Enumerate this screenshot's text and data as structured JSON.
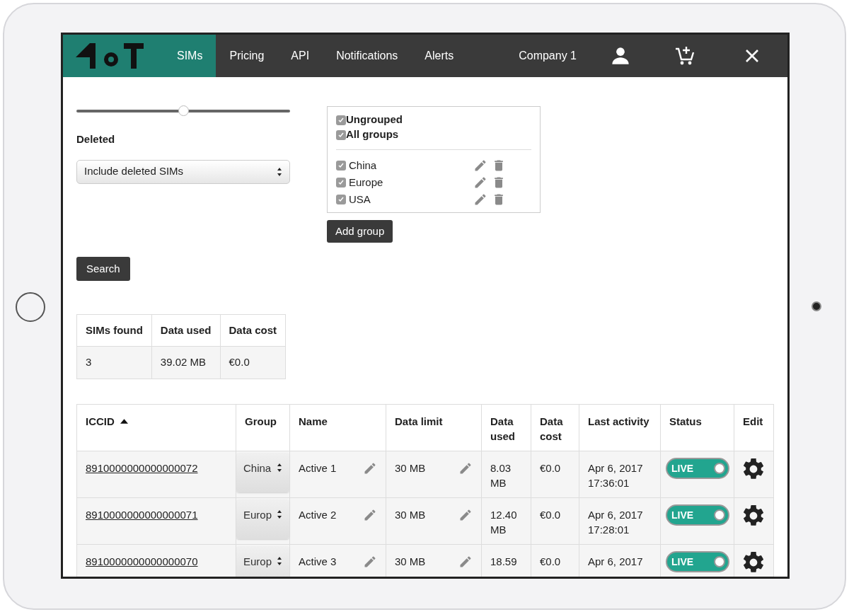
{
  "nav": {
    "tabs": [
      {
        "label": "SIMs",
        "selected": true
      },
      {
        "label": "Pricing",
        "selected": false
      },
      {
        "label": "API",
        "selected": false
      },
      {
        "label": "Notifications",
        "selected": false
      },
      {
        "label": "Alerts",
        "selected": false
      }
    ],
    "company": "Company 1"
  },
  "filters": {
    "slider": {
      "level": 0.5
    },
    "deleted_label": "Deleted",
    "deleted_value": "Include deleted SIMs",
    "search_button": "Search"
  },
  "group_filter": {
    "special": [
      {
        "label": "Ungrouped",
        "checked": true
      },
      {
        "label": "All groups",
        "checked": true
      }
    ],
    "groups": [
      {
        "label": "China",
        "checked": true
      },
      {
        "label": "Europe",
        "checked": true
      },
      {
        "label": "USA",
        "checked": true
      }
    ],
    "add_button": "Add group"
  },
  "summary": {
    "columns": [
      "SIMs found",
      "Data used",
      "Data cost"
    ],
    "values": [
      "3",
      "39.02 MB",
      "€0.0"
    ]
  },
  "table": {
    "columns": [
      {
        "label": "ICCID",
        "sorted": true
      },
      {
        "label": "Group",
        "sorted": false
      },
      {
        "label": "Name",
        "sorted": false
      },
      {
        "label": "Data limit",
        "sorted": false
      },
      {
        "label": "Data used",
        "sorted": false
      },
      {
        "label": "Data cost",
        "sorted": false
      },
      {
        "label": "Last activity",
        "sorted": false
      },
      {
        "label": "Status",
        "sorted": false
      },
      {
        "label": "Edit",
        "sorted": false
      }
    ],
    "rows": [
      {
        "iccid": "8910000000000000072",
        "group": "China",
        "name": "Active 1",
        "data_limit": "30 MB",
        "data_used": "8.03 MB",
        "data_cost": "€0.0",
        "last_activity": "Apr 6, 2017 17:36:01",
        "status": {
          "label": "LIVE",
          "on": true
        }
      },
      {
        "iccid": "8910000000000000071",
        "group": "Europ",
        "name": "Active 2",
        "data_limit": "30 MB",
        "data_used": "12.40 MB",
        "data_cost": "€0.0",
        "last_activity": "Apr 6, 2017 17:28:01",
        "status": {
          "label": "LIVE",
          "on": true
        }
      },
      {
        "iccid": "8910000000000000070",
        "group": "Europ",
        "name": "Active 3",
        "data_limit": "30 MB",
        "data_used": "18.59",
        "data_cost": "€0.0",
        "last_activity": "Apr 6, 2017",
        "status": {
          "label": "LIVE",
          "on": true
        }
      }
    ]
  }
}
